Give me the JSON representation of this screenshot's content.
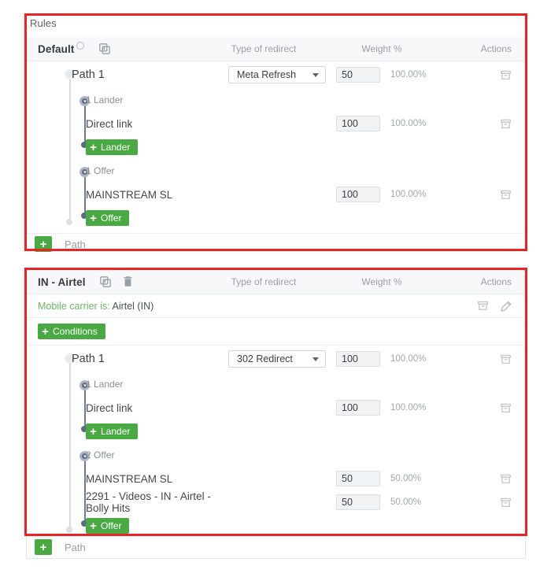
{
  "page": {
    "rules_caption": "Rules"
  },
  "columns": {
    "redirect": "Type of redirect",
    "weight": "Weight %",
    "actions": "Actions"
  },
  "buttons": {
    "add_lander": "Lander",
    "add_offer": "Offer",
    "add_conditions": "Conditions",
    "add_path": "Path",
    "plus": "+"
  },
  "icons": {
    "duplicate": "duplicate-icon",
    "trash": "trash-icon",
    "archive": "archive-icon",
    "pencil": "pencil-icon",
    "info": "info-icon",
    "caret": "chevron-down-icon"
  },
  "rules": [
    {
      "id": "default",
      "title": "Default",
      "has_info": true,
      "has_duplicate": true,
      "has_trash": false,
      "condition": null,
      "paths": [
        {
          "name": "Path 1",
          "redirect": "Meta Refresh",
          "weight": "50",
          "percent": "100.00%",
          "groups": [
            {
              "label": "1 Lander",
              "add_label": "Lander",
              "items": [
                {
                  "name": "Direct link",
                  "weight": "100",
                  "percent": "100.00%"
                }
              ]
            },
            {
              "label": "1 Offer",
              "add_label": "Offer",
              "items": [
                {
                  "name": "MAINSTREAM SL",
                  "weight": "100",
                  "percent": "100.00%"
                }
              ]
            }
          ]
        }
      ]
    },
    {
      "id": "in-airtel",
      "title": "IN - Airtel",
      "has_info": false,
      "has_duplicate": true,
      "has_trash": true,
      "condition": {
        "label": "Mobile carrier is:",
        "value": "Airtel (IN)"
      },
      "paths": [
        {
          "name": "Path 1",
          "redirect": "302 Redirect",
          "weight": "100",
          "percent": "100.00%",
          "groups": [
            {
              "label": "1 Lander",
              "add_label": "Lander",
              "items": [
                {
                  "name": "Direct link",
                  "weight": "100",
                  "percent": "100.00%"
                }
              ]
            },
            {
              "label": "2 Offer",
              "add_label": "Offer",
              "items": [
                {
                  "name": "MAINSTREAM SL",
                  "weight": "50",
                  "percent": "50.00%"
                },
                {
                  "name": "2291 - Videos - IN - Airtel - Bolly Hits",
                  "weight": "50",
                  "percent": "50.00%"
                }
              ]
            }
          ]
        }
      ]
    }
  ],
  "colors": {
    "annotation": "#ee2222",
    "green": "#49a942",
    "condition_text": "#6aba62"
  }
}
